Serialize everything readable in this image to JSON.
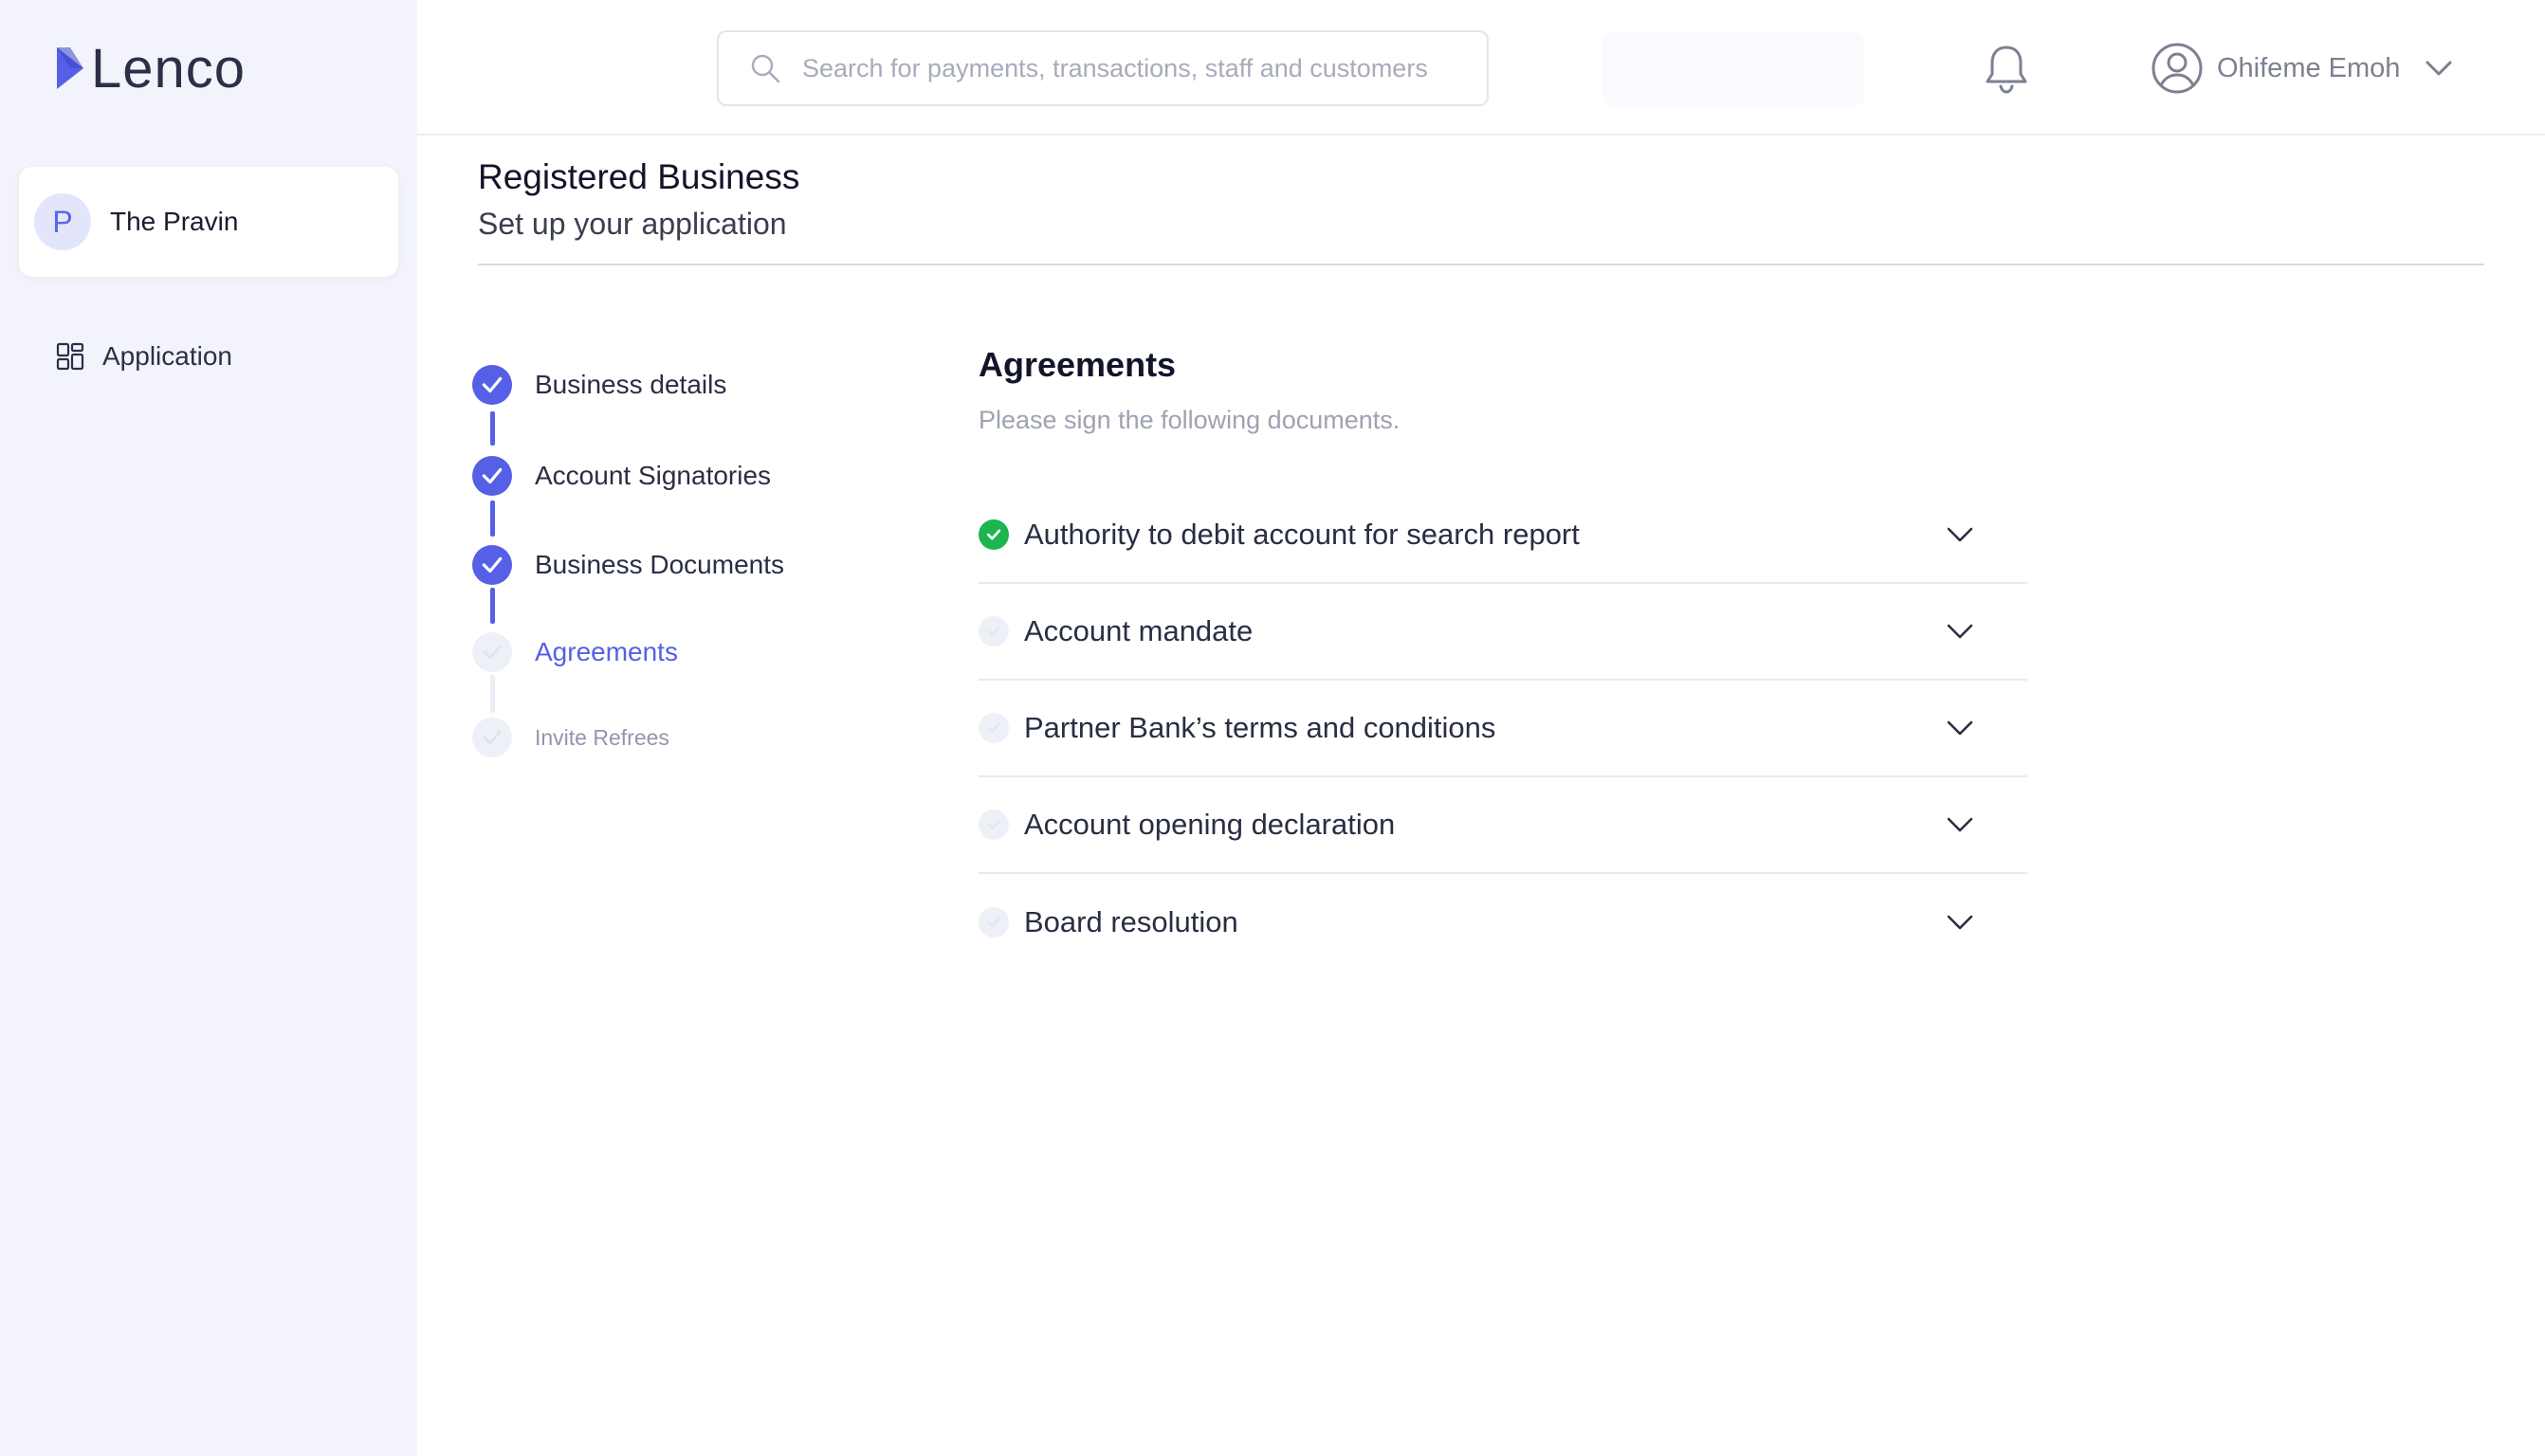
{
  "app": {
    "logo_text": "Lenco"
  },
  "sidebar": {
    "account": {
      "initial": "P",
      "name": "The Pravin"
    },
    "nav": [
      {
        "label": "Application",
        "icon": "grid-icon"
      }
    ]
  },
  "header": {
    "search": {
      "placeholder": "Search for payments, transactions, staff and customers",
      "value": ""
    },
    "user": {
      "name": "Ohifeme Emoh"
    }
  },
  "page": {
    "title": "Registered Business",
    "subtitle": "Set up your application"
  },
  "steps": [
    {
      "label": "Business details",
      "status": "done"
    },
    {
      "label": "Account Signatories",
      "status": "done"
    },
    {
      "label": "Business Documents",
      "status": "done"
    },
    {
      "label": "Agreements",
      "status": "active"
    },
    {
      "label": "Invite Refrees",
      "status": "pending"
    }
  ],
  "agreements": {
    "title": "Agreements",
    "description": "Please sign the following documents.",
    "documents": [
      {
        "label": "Authority to debit account for search report",
        "signed": true
      },
      {
        "label": "Account mandate",
        "signed": false
      },
      {
        "label": "Partner Bank’s terms and conditions",
        "signed": false
      },
      {
        "label": "Account opening declaration",
        "signed": false
      },
      {
        "label": "Board resolution",
        "signed": false
      }
    ]
  },
  "colors": {
    "accent": "#5560e6",
    "success": "#1cb54e",
    "sidebar_bg": "#f3f4fb"
  }
}
